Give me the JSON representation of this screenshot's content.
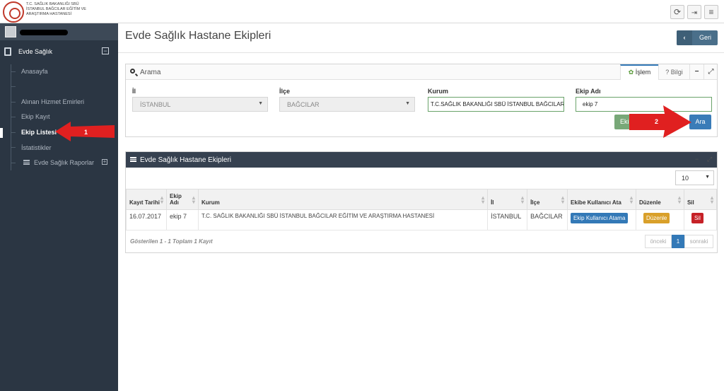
{
  "header": {
    "logo_lines": [
      "T.C. SAĞLIK BAKANLIĞI SBÜ",
      "İSTANBUL BAĞCILAR EĞİTİM VE",
      "ARAŞTIRMA HASTANESİ"
    ],
    "buttons": [
      "refresh-icon",
      "logout-icon",
      "menu-icon"
    ]
  },
  "sidebar": {
    "section_label": "Evde Sağlık",
    "items": [
      {
        "label": "Anasayfa"
      },
      {
        "label": "Alınan Hizmet Emirleri"
      },
      {
        "label": "Ekip Kayıt"
      },
      {
        "label": "Ekip Listesi",
        "active": true
      },
      {
        "label": "İstatistikler"
      },
      {
        "label": "Evde Sağlık Raporlar"
      }
    ]
  },
  "page": {
    "title": "Evde Sağlık Hastane Ekipleri",
    "back_label": "Geri"
  },
  "search": {
    "title": "Arama",
    "tab_islem": "İşlem",
    "tab_bilgi": "Bilgi",
    "fields": {
      "il_label": "İl",
      "il_value": "İSTANBUL",
      "ilce_label": "İlçe",
      "ilce_value": "BAĞCILAR",
      "kurum_label": "Kurum",
      "kurum_value": "T.C.SAĞLIK BAKANLIĞI SBÜ İSTANBUL BAĞCILAR",
      "ekip_label": "Ekip Adı",
      "ekip_value": "ekip 7"
    },
    "green_button_label": "Ekip",
    "search_button_label": "Ara"
  },
  "results": {
    "title": "Evde Sağlık Hastane Ekipleri",
    "page_size": "10",
    "columns": [
      "Kayıt Tarihi",
      "Ekip Adı",
      "Kurum",
      "İl",
      "İlçe",
      "Ekibe Kullanıcı Ata",
      "Düzenle",
      "Sil"
    ],
    "rows": [
      {
        "date": "16.07.2017",
        "team": "ekip 7",
        "institution": "T.C. SAĞLIK BAKANLIĞI SBÜ İSTANBUL BAĞCILAR EĞİTİM VE ARAŞTIRMA HASTANESİ",
        "province": "İSTANBUL",
        "district": "BAĞCILAR",
        "assign_label": "Ekip Kullanıcı Atama",
        "edit_label": "Düzenle",
        "delete_label": "Sil"
      }
    ],
    "footer": "Gösterilen 1 - 1 Toplam 1 Kayıt",
    "pagination": {
      "prev": "önceki",
      "current": "1",
      "next": "sonraki"
    }
  },
  "annotations": [
    {
      "number": "1",
      "color": "#e02020"
    },
    {
      "number": "2",
      "color": "#e02020"
    }
  ]
}
